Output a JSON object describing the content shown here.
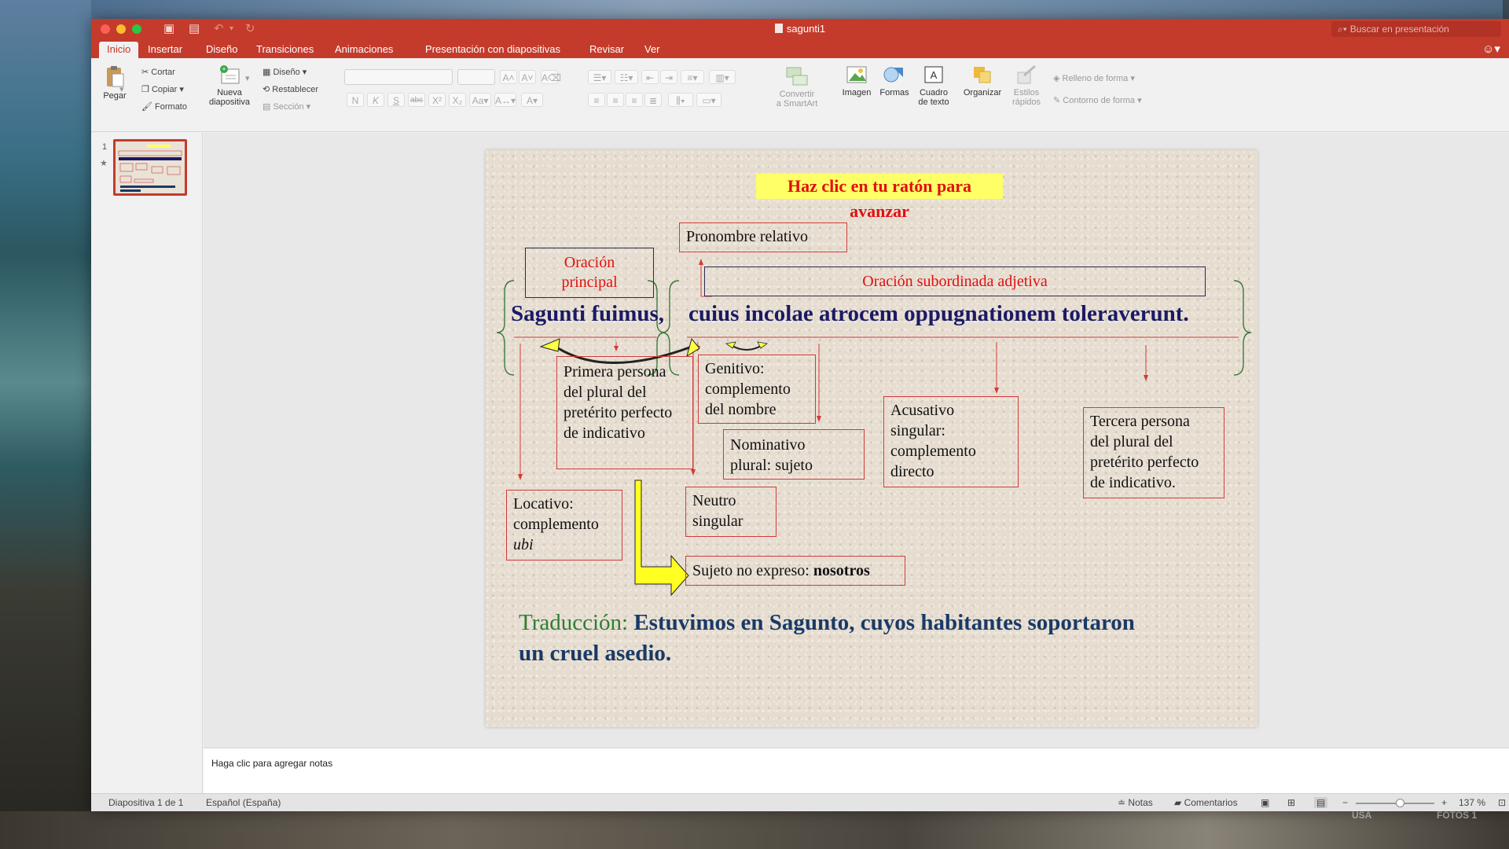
{
  "window": {
    "title": "sagunti1",
    "search_placeholder": "Buscar en presentación"
  },
  "tabs": [
    "Inicio",
    "Insertar",
    "Diseño",
    "Transiciones",
    "Animaciones",
    "Presentación con diapositivas",
    "Revisar",
    "Ver"
  ],
  "active_tab": "Inicio",
  "ribbon": {
    "paste": "Pegar",
    "cut": "Cortar",
    "copy": "Copiar",
    "format": "Formato",
    "new_slide_1": "Nueva",
    "new_slide_2": "diapositiva",
    "layout": "Diseño",
    "reset": "Restablecer",
    "section": "Sección",
    "bold": "N",
    "italic": "K",
    "underline": "S",
    "strike": "abc",
    "superscript": "X²",
    "subscript": "X₂",
    "convert_1": "Convertir",
    "convert_2": "a SmartArt",
    "image": "Imagen",
    "shapes": "Formas",
    "textbox_1": "Cuadro",
    "textbox_2": "de texto",
    "arrange": "Organizar",
    "quick_styles_1": "Estilos",
    "quick_styles_2": "rápidos",
    "shape_fill": "Relleno de forma",
    "shape_outline": "Contorno de forma"
  },
  "thumbnails": [
    {
      "number": "1"
    }
  ],
  "slide": {
    "banner": "Haz clic en tu ratón para avanzar",
    "relative_pronoun": "Pronombre relativo",
    "main_clause_1": "Oración",
    "main_clause_2": "principal",
    "subordinate": "Oración subordinada adjetiva",
    "sentence_main": "Sagunti fuimus,",
    "sentence_sub": "cuius incolae atrocem oppugnationem toleraverunt.",
    "note_verb": [
      "Primera persona",
      "del plural del",
      "pretérito perfecto",
      "de indicativo"
    ],
    "note_genitive": [
      "Genitivo:",
      "complemento",
      "del nombre"
    ],
    "note_nominative": [
      "Nominativo",
      "plural: sujeto"
    ],
    "note_accusative": [
      "Acusativo",
      "singular:",
      "complemento",
      "directo"
    ],
    "note_third": [
      "Tercera persona",
      "del plural del",
      "pretérito perfecto",
      "de indicativo."
    ],
    "note_locative": [
      "Locativo:",
      "complemento"
    ],
    "note_locative_ubi": "ubi",
    "note_neuter": [
      "Neutro",
      "singular"
    ],
    "note_subject_prefix": "Sujeto no expreso: ",
    "note_subject_bold": "nosotros",
    "translation_label": "Traducción:",
    "translation_line1": "Estuvimos en Sagunto, cuyos habitantes soportaron",
    "translation_line2": "un cruel asedio."
  },
  "notes_placeholder": "Haga clic para agregar notas",
  "status": {
    "slide_counter": "Diapositiva 1 de 1",
    "language": "Español (España)",
    "notes": "Notas",
    "comments": "Comentarios",
    "zoom": "137 %"
  },
  "desktop_labels": [
    "USA",
    "FOTOS 1"
  ],
  "colors": {
    "accent": "#c43b2c",
    "slide_red": "#d23a3a",
    "slide_navy": "#1a1a66",
    "translation_green": "#2e7d32",
    "banner_yellow": "#ffff66"
  }
}
